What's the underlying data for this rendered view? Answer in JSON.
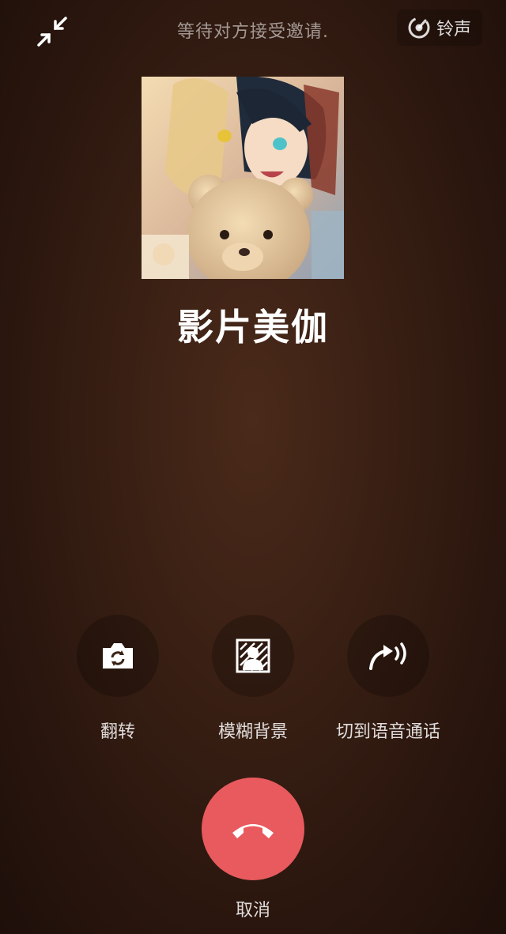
{
  "header": {
    "status_text": "等待对方接受邀请.",
    "ringtone_label": "铃声"
  },
  "contact": {
    "name": "影片美伽"
  },
  "actions": [
    {
      "label": "翻转",
      "icon": "camera-flip-icon"
    },
    {
      "label": "模糊背景",
      "icon": "blur-background-icon"
    },
    {
      "label": "切到语音通话",
      "icon": "voice-call-switch-icon"
    }
  ],
  "hangup": {
    "label": "取消",
    "icon": "hang-up-icon"
  },
  "colors": {
    "background": "#3a2014",
    "hangup": "#e85a5e"
  }
}
